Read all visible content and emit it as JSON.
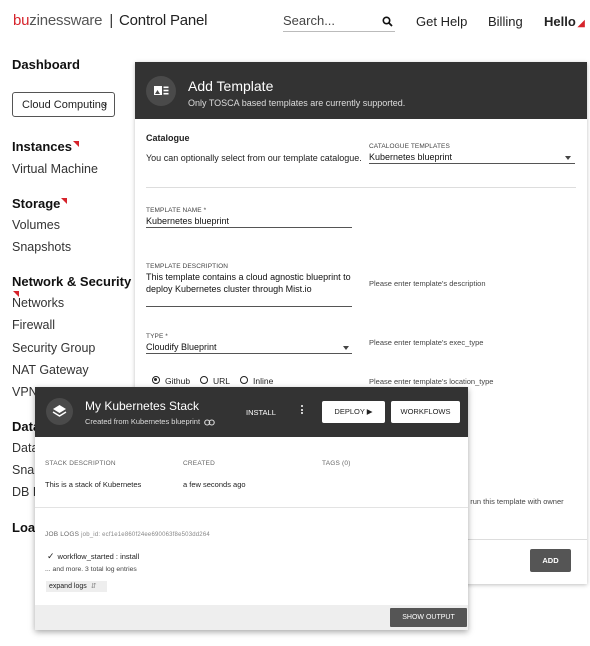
{
  "header": {
    "logo_red": "bu",
    "logo_grey": "zinessware",
    "logo_separator": "|",
    "app_title": "Control Panel",
    "search_placeholder": "Search...",
    "get_help": "Get Help",
    "billing": "Billing",
    "hello": "Hello"
  },
  "sidebar": {
    "dashboard": "Dashboard",
    "selector_value": "Cloud Computing",
    "instances": "Instances",
    "virtual_machine": "Virtual Machine",
    "storage": "Storage",
    "volumes": "Volumes",
    "snapshots": "Snapshots",
    "network_security": "Network & Security",
    "networks": "Networks",
    "firewall": "Firewall",
    "security_group": "Security Group",
    "nat_gateway": "NAT Gateway",
    "vpn": "VPN",
    "partial_data": "Data",
    "partial_data2": "Data",
    "partial_snap": "Snap",
    "partial_db": "DB B",
    "partial_load": "Load"
  },
  "add_template": {
    "title": "Add Template",
    "subtitle": "Only TOSCA based templates are currently supported.",
    "catalogue_heading": "Catalogue",
    "catalogue_text": "You can optionally select from our template catalogue.",
    "catalogue_templates_label": "CATALOGUE TEMPLATES",
    "catalogue_templates_value": "Kubernetes blueprint",
    "template_name_label": "TEMPLATE NAME *",
    "template_name_value": "Kubernetes blueprint",
    "template_description_label": "TEMPLATE DESCRIPTION",
    "template_description_line1": "This template contains a cloud agnostic blueprint to",
    "template_description_line2": "deploy Kubernetes cluster through Mist.io",
    "description_hint": "Please enter template's description",
    "type_label": "TYPE *",
    "type_value": "Cloudify Blueprint",
    "type_hint": "Please enter template's exec_type",
    "location_options": [
      "Github",
      "URL",
      "Inline"
    ],
    "location_hint": "Please enter template's location_type",
    "owner_hint_partial": "o run this template with owner",
    "add_button": "ADD"
  },
  "stack": {
    "title": "My Kubernetes Stack",
    "subtitle": "Created from Kubernetes blueprint",
    "install": "INSTALL",
    "deploy": "DEPLOY",
    "workflows": "WORKFLOWS",
    "desc_label": "STACK DESCRIPTION",
    "desc_value": "This is a stack of Kubernetes",
    "created_label": "CREATED",
    "created_value": "a few seconds ago",
    "tags_label": "TAGS (0)",
    "job_logs_label": "JOB LOGS",
    "job_id": "job_id: ecf1e1e860f24ee690063f8e503dd264",
    "log_entry": "workflow_started : install",
    "more_entries": "... and more. 3 total log entries",
    "expand_logs": "expand logs",
    "show_output": "SHOW OUTPUT"
  }
}
